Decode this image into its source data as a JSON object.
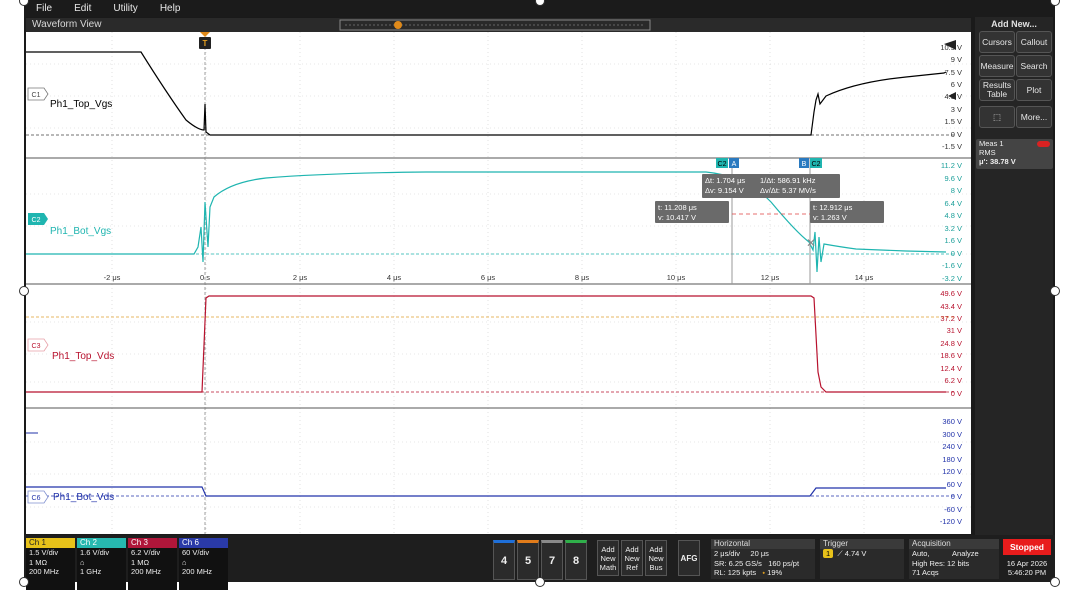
{
  "menu": {
    "file": "File",
    "edit": "Edit",
    "utility": "Utility",
    "help": "Help"
  },
  "view_title": "Waveform View",
  "panel": {
    "title": "Add New...",
    "cursors": "Cursors",
    "callout": "Callout",
    "measure": "Measure",
    "search": "Search",
    "results_table": "Results Table",
    "plot": "Plot",
    "more": "More..."
  },
  "meas": {
    "title": "Meas 1",
    "type": "RMS",
    "value": "μ': 38.78 V"
  },
  "trigger_marker": "T",
  "waveforms": {
    "ch1": {
      "tag": "C1",
      "label": "Ph1_Top_Vgs",
      "color": "#000000"
    },
    "ch2": {
      "tag": "C2",
      "label": "Ph1_Bot_Vgs",
      "color": "#1fb5b0"
    },
    "ch3": {
      "tag": "C3",
      "label": "Ph1_Top_Vds",
      "color": "#b8122e"
    },
    "ch6": {
      "tag": "C6",
      "label": "Ph1_Bot_Vds",
      "color": "#2233aa"
    }
  },
  "scales": {
    "ch1": [
      "10.5 V",
      "9 V",
      "7.5 V",
      "6 V",
      "4.5 V",
      "3 V",
      "1.5 V",
      "0 V",
      "-1.5 V"
    ],
    "ch2": [
      "11.2 V",
      "9.6 V",
      "8 V",
      "6.4 V",
      "4.8 V",
      "3.2 V",
      "1.6 V",
      "0 V",
      "-1.6 V",
      "-3.2 V"
    ],
    "ch3": [
      "49.6 V",
      "43.4 V",
      "37.2 V",
      "31 V",
      "24.8 V",
      "18.6 V",
      "12.4 V",
      "6.2 V",
      "0 V"
    ],
    "ch6": [
      "360 V",
      "300 V",
      "240 V",
      "180 V",
      "120 V",
      "60 V",
      "0 V",
      "-60 V",
      "-120 V"
    ]
  },
  "time_labels": [
    "-2 μs",
    "0 s",
    "2 μs",
    "4 μs",
    "6 μs",
    "8 μs",
    "10 μs",
    "12 μs",
    "14 μs"
  ],
  "cursor": {
    "a_label": "A",
    "b_label": "B",
    "c2_label": "C2",
    "delta_t": "Δt: 1.704 μs",
    "inv_delta_t": "1/Δt: 586.91 kHz",
    "delta_v": "Δv: 9.154 V",
    "dv_dt": "Δv/Δt: 5.37 MV/s",
    "a_t": "t: 11.208 μs",
    "a_v": "v: 10.417 V",
    "b_t": "t: 12.912 μs",
    "b_v": "v: 1.263 V"
  },
  "channels": [
    {
      "name": "Ch 1",
      "color": "#e8c21a",
      "l1": "1.5 V/div",
      "l2": "1 MΩ",
      "l3": "200 MHz"
    },
    {
      "name": "Ch 2",
      "color": "#27b8b0",
      "l1": "1.6 V/div",
      "l2": "",
      "l3": "1 GHz"
    },
    {
      "name": "Ch 3",
      "color": "#b0163a",
      "l1": "6.2 V/div",
      "l2": "1 MΩ",
      "l3": "200 MHz"
    },
    {
      "name": "Ch 6",
      "color": "#2a3aa8",
      "l1": "60 V/div",
      "l2": "",
      "l3": "200 MHz"
    }
  ],
  "num_buttons": [
    {
      "label": "4",
      "color": "#1e6fd9"
    },
    {
      "label": "5",
      "color": "#e07b1a"
    },
    {
      "label": "7",
      "color": "#8a8a8a"
    },
    {
      "label": "8",
      "color": "#2fb04a"
    }
  ],
  "new_buttons": {
    "math": "Add New Math",
    "ref": "Add New Ref",
    "bus": "Add New Bus",
    "afg": "AFG"
  },
  "horizontal": {
    "title": "Horizontal",
    "scale": "2 μs/div",
    "record": "20 μs",
    "sr": "SR: 6.25 GS/s",
    "pts": "160 ps/pt",
    "rl": "RL: 125 kpts",
    "pos": "19%"
  },
  "trigger": {
    "title": "Trigger",
    "source": "1",
    "level": "4.74 V"
  },
  "acquisition": {
    "title": "Acquisition",
    "mode": "Auto,",
    "analyze": "Analyze",
    "res": "High Res: 12 bits",
    "acqs": "71 Acqs"
  },
  "status": "Stopped",
  "date": "16 Apr 2026",
  "time": "5:46:20 PM"
}
